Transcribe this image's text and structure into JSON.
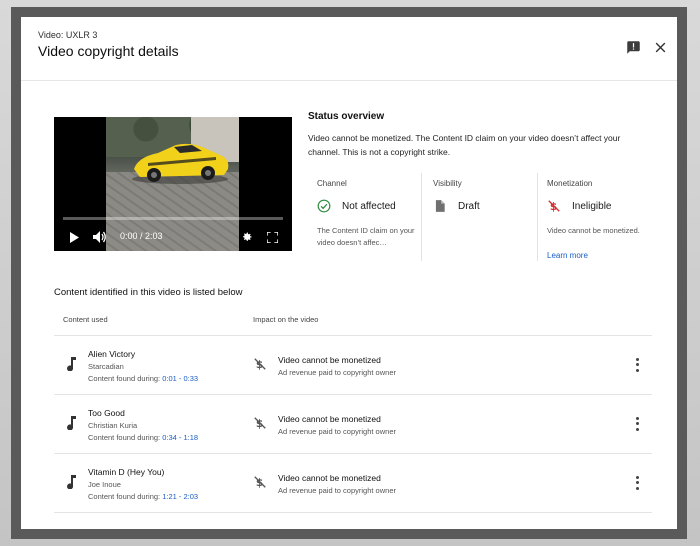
{
  "header": {
    "subtitle": "Video: UXLR 3",
    "title": "Video copyright details"
  },
  "player": {
    "time": "0:00 / 2:03",
    "progress": 0
  },
  "status": {
    "title": "Status overview",
    "description": "Video cannot be monetized. The Content ID claim on your video doesn’t affect your channel. This is not a copyright strike.",
    "cards": [
      {
        "label": "Channel",
        "value": "Not affected",
        "note": "The Content ID claim on your video doesn’t affec…",
        "icon": "check-circle-icon"
      },
      {
        "label": "Visibility",
        "value": "Draft",
        "icon": "file-icon"
      },
      {
        "label": "Monetization",
        "value": "Ineligible",
        "note": "Video cannot be monetized.",
        "link": "Learn more",
        "icon": "no-dollar-icon"
      }
    ]
  },
  "content": {
    "title": "Content identified in this video is listed below",
    "col_content": "Content used",
    "col_impact": "Impact on the video",
    "found_label": "Content found during:",
    "rows": [
      {
        "title": "Alien Victory",
        "artist": "Starcadian",
        "range": "0:01 - 0:33",
        "impact": "Video cannot be monetized",
        "impact_sub": "Ad revenue paid to copyright owner"
      },
      {
        "title": "Too Good",
        "artist": "Christian Kuria",
        "range": "0:34 - 1:18",
        "impact": "Video cannot be monetized",
        "impact_sub": "Ad revenue paid to copyright owner"
      },
      {
        "title": "Vitamin D (Hey You)",
        "artist": "Joe Inoue",
        "range": "1:21 - 2:03",
        "impact": "Video cannot be monetized",
        "impact_sub": "Ad revenue paid to copyright owner"
      }
    ]
  },
  "colors": {
    "link": "#1a5ec4",
    "success": "#2e8b3d",
    "alert": "#d32f2f"
  }
}
